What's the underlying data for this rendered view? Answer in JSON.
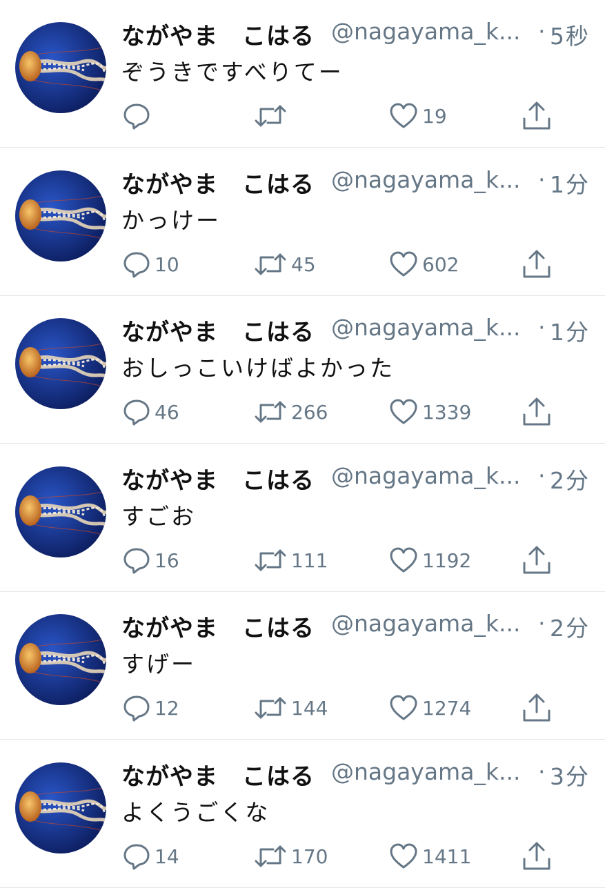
{
  "theme": {
    "name_color": "#111111",
    "meta_color": "#657786",
    "divider_color": "#e1e6ea",
    "avatar_bg": "#0b1e6e"
  },
  "icons": {
    "reply": "speech-bubble-icon",
    "retweet": "retweet-arrows-icon",
    "like": "heart-icon",
    "share": "share-upload-icon"
  },
  "tweets": [
    {
      "name": "ながやま　こはる",
      "handle": "@nagayama_k...",
      "dot": "·",
      "time": "5秒",
      "text": "ぞうきですべりてー",
      "replies": "",
      "retweets": "",
      "likes": "19"
    },
    {
      "name": "ながやま　こはる",
      "handle": "@nagayama_k...",
      "dot": "·",
      "time": "1分",
      "text": "かっけー",
      "replies": "10",
      "retweets": "45",
      "likes": "602"
    },
    {
      "name": "ながやま　こはる",
      "handle": "@nagayama_k...",
      "dot": "·",
      "time": "1分",
      "text": "おしっこいけばよかった",
      "replies": "46",
      "retweets": "266",
      "likes": "1339"
    },
    {
      "name": "ながやま　こはる",
      "handle": "@nagayama_k...",
      "dot": "·",
      "time": "2分",
      "text": "すごお",
      "replies": "16",
      "retweets": "111",
      "likes": "1192"
    },
    {
      "name": "ながやま　こはる",
      "handle": "@nagayama_k...",
      "dot": "·",
      "time": "2分",
      "text": "すげー",
      "replies": "12",
      "retweets": "144",
      "likes": "1274"
    },
    {
      "name": "ながやま　こはる",
      "handle": "@nagayama_k...",
      "dot": "·",
      "time": "3分",
      "text": "よくうごくな",
      "replies": "14",
      "retweets": "170",
      "likes": "1411"
    }
  ]
}
